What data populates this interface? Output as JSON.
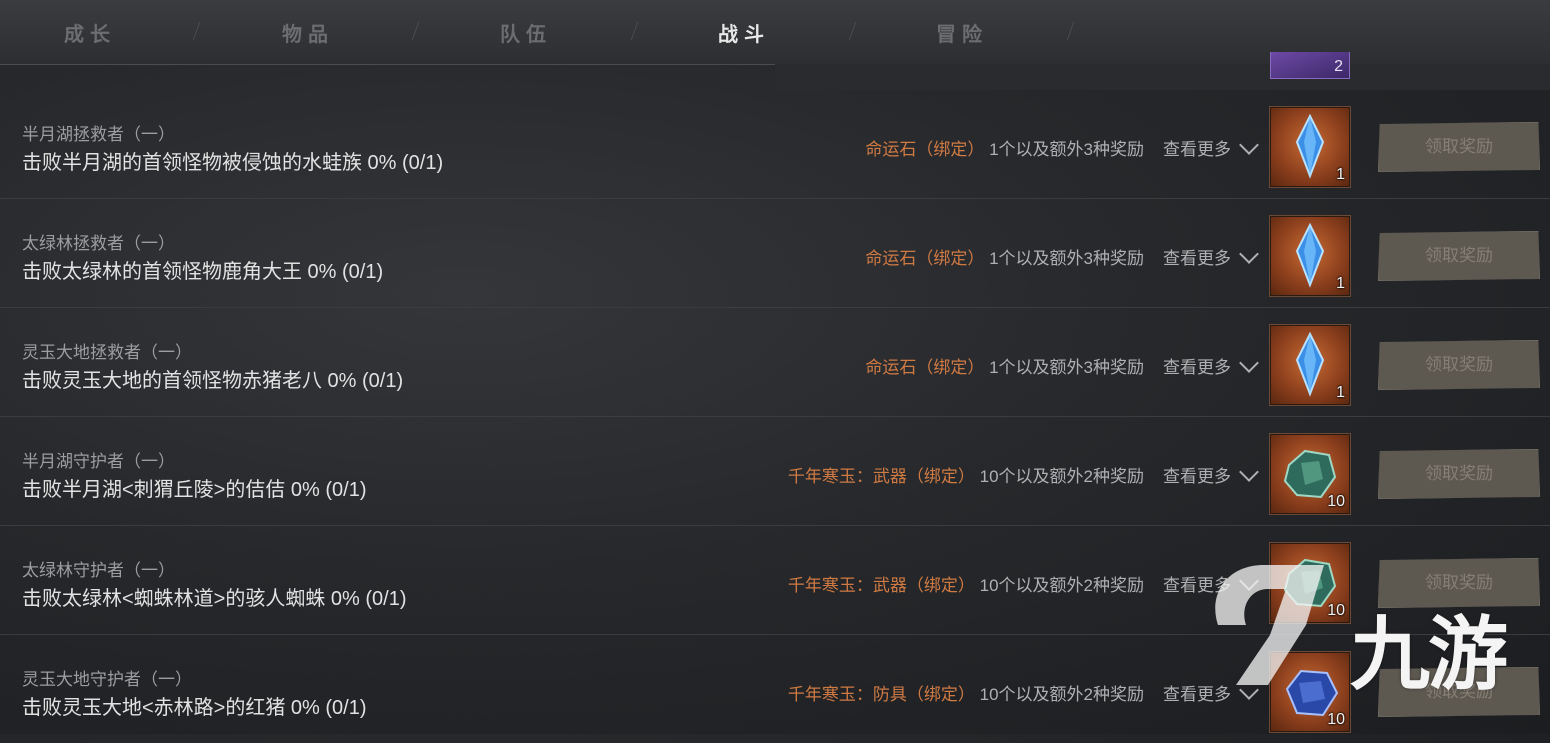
{
  "tabs": [
    {
      "label": "成长",
      "active": false
    },
    {
      "label": "物品",
      "active": false
    },
    {
      "label": "队伍",
      "active": false
    },
    {
      "label": "战斗",
      "active": true
    },
    {
      "label": "冒险",
      "active": false
    }
  ],
  "peek_item": {
    "count": "2"
  },
  "rows": [
    {
      "title": "半月湖拯救者（一）",
      "desc": "击败半月湖的首领怪物被侵蚀的水蛙族 0% (0/1)",
      "reward_name": "命运石（绑定）",
      "reward_qty": "1个以及额外3种奖励",
      "more": "查看更多",
      "item_icon": "blue-crystal-icon",
      "item_count": "1",
      "claim": "领取奖励"
    },
    {
      "title": "太绿林拯救者（一）",
      "desc": "击败太绿林的首领怪物鹿角大王 0% (0/1)",
      "reward_name": "命运石（绑定）",
      "reward_qty": "1个以及额外3种奖励",
      "more": "查看更多",
      "item_icon": "blue-crystal-icon",
      "item_count": "1",
      "claim": "领取奖励"
    },
    {
      "title": "灵玉大地拯救者（一）",
      "desc": "击败灵玉大地的首领怪物赤猪老八 0% (0/1)",
      "reward_name": "命运石（绑定）",
      "reward_qty": "1个以及额外3种奖励",
      "more": "查看更多",
      "item_icon": "blue-crystal-icon",
      "item_count": "1",
      "claim": "领取奖励"
    },
    {
      "title": "半月湖守护者（一）",
      "desc": "击败半月湖<刺猬丘陵>的佶佶 0% (0/1)",
      "reward_name": "千年寒玉：武器（绑定）",
      "reward_qty": "10个以及额外2种奖励",
      "more": "查看更多",
      "item_icon": "green-jade-icon",
      "item_count": "10",
      "claim": "领取奖励"
    },
    {
      "title": "太绿林守护者（一）",
      "desc": "击败太绿林<蜘蛛林道>的骇人蜘蛛 0% (0/1)",
      "reward_name": "千年寒玉：武器（绑定）",
      "reward_qty": "10个以及额外2种奖励",
      "more": "查看更多",
      "item_icon": "green-jade-icon",
      "item_count": "10",
      "claim": "领取奖励"
    },
    {
      "title": "灵玉大地守护者（一）",
      "desc": "击败灵玉大地<赤林路>的红猪 0% (0/1)",
      "reward_name": "千年寒玉：防具（绑定）",
      "reward_qty": "10个以及额外2种奖励",
      "more": "查看更多",
      "item_icon": "blue-jade-icon",
      "item_count": "10",
      "claim": "领取奖励"
    }
  ],
  "watermark": {
    "text": "九游"
  },
  "colors": {
    "accent_reward": "#d07a43",
    "active_tab": "#e8e8e8",
    "inactive_tab": "#6b6d70"
  }
}
